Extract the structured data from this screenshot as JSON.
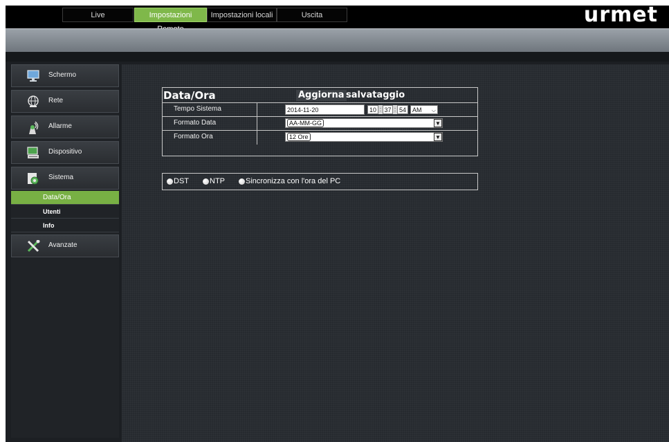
{
  "nav": {
    "tabs": [
      {
        "label": "Live",
        "active": false
      },
      {
        "label": "Impostazioni Remote",
        "active": true
      },
      {
        "label": "Impostazioni locali",
        "active": false
      },
      {
        "label": "Uscita",
        "active": false
      }
    ],
    "logo": "urmet"
  },
  "sidebar": {
    "items": [
      {
        "label": "Schermo",
        "icon": "monitor-icon"
      },
      {
        "label": "Rete",
        "icon": "network-icon"
      },
      {
        "label": "Allarme",
        "icon": "alarm-icon"
      },
      {
        "label": "Dispositivo",
        "icon": "device-icon"
      },
      {
        "label": "Sistema",
        "icon": "system-icon"
      },
      {
        "label": "Avanzate",
        "icon": "tools-icon"
      }
    ],
    "submenu": [
      {
        "label": "Data/Ora",
        "active": true
      },
      {
        "label": "Utenti",
        "active": false
      },
      {
        "label": "Info",
        "active": false
      }
    ]
  },
  "panel": {
    "title": "Data/Ora",
    "refresh_label": "Aggiorna",
    "save_label": "salvataggio",
    "rows": {
      "system_time": {
        "label": "Tempo Sistema",
        "date": "2014-11-20",
        "hour": "10",
        "minute": "37",
        "second": "54",
        "ampm": "AM"
      },
      "date_format": {
        "label": "Formato Data",
        "value": "AA-MM-GG"
      },
      "time_format": {
        "label": "Formato Ora",
        "value": "12 Ore"
      }
    }
  },
  "options": {
    "dst": "DST",
    "ntp": "NTP",
    "sync_pc": "Sincronizza con l'ora del PC"
  },
  "colors": {
    "accent": "#78b044",
    "background": "#262a2f",
    "topbar": "#000000"
  }
}
